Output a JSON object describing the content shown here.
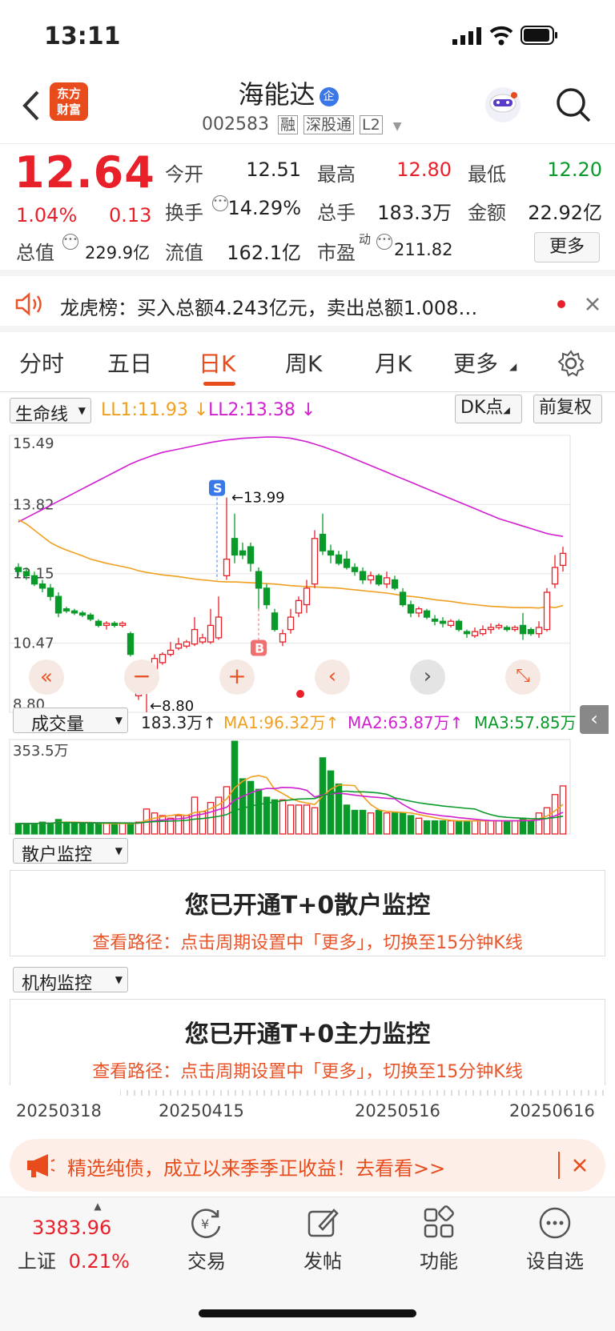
{
  "status": {
    "time": "13:11"
  },
  "header": {
    "name": "海能达",
    "name_badge": "企",
    "code": "002583",
    "tags": [
      "融",
      "深股通",
      "L2"
    ],
    "logo_top": "东方",
    "logo_bottom": "财富"
  },
  "quote": {
    "price": "12.64",
    "change_pct": "1.04%",
    "change": "0.13",
    "fields": [
      {
        "label": "今开",
        "value": "12.51",
        "color": "#222222"
      },
      {
        "label": "最高",
        "value": "12.80",
        "color": "#e8202a"
      },
      {
        "label": "最低",
        "value": "12.20",
        "color": "#0a9a2a"
      },
      {
        "label": "换手",
        "value": "14.29%",
        "color": "#222222"
      },
      {
        "label": "总手",
        "value": "183.3万",
        "color": "#222222"
      },
      {
        "label": "金额",
        "value": "22.92亿",
        "color": "#222222"
      },
      {
        "label": "总值",
        "value": "229.9亿",
        "color": "#222222"
      },
      {
        "label": "流值",
        "value": "162.1亿",
        "color": "#222222"
      },
      {
        "label": "市盈",
        "value": "211.82",
        "color": "#222222"
      }
    ],
    "pe_sup": "动",
    "more_label": "更多"
  },
  "notice": {
    "text": "龙虎榜：买入总额4.243亿元，卖出总额1.008…"
  },
  "tabs": [
    "分时",
    "五日",
    "日K",
    "周K",
    "月K",
    "更多"
  ],
  "active_tab": "日K",
  "indicator": {
    "selector": "生命线",
    "ll1": "LL1:11.93",
    "ll2": "LL2:13.38",
    "dk_label": "DK点",
    "fq_label": "前复权"
  },
  "chart_data": {
    "type": "candlestick",
    "y_axis_labels": [
      "15.49",
      "13.82",
      "12.15",
      "10.47",
      "8.80"
    ],
    "ylim": [
      8.8,
      15.49
    ],
    "annotations": [
      {
        "label": "S",
        "value": "13.99"
      },
      {
        "label": "B",
        "value": ""
      },
      {
        "label": "low",
        "value": "8.80"
      }
    ],
    "candles": [
      [
        12.3,
        12.2,
        12.4,
        12.1
      ],
      [
        12.2,
        12.1,
        12.3,
        12.0
      ],
      [
        12.1,
        11.9,
        12.2,
        11.85
      ],
      [
        11.9,
        11.8,
        12.0,
        11.7
      ],
      [
        11.8,
        11.6,
        11.9,
        11.5
      ],
      [
        11.6,
        11.2,
        11.7,
        11.1
      ],
      [
        11.3,
        11.25,
        11.35,
        11.2
      ],
      [
        11.25,
        11.2,
        11.3,
        11.15
      ],
      [
        11.2,
        11.15,
        11.25,
        11.1
      ],
      [
        11.15,
        11.05,
        11.2,
        11.0
      ],
      [
        11.0,
        10.9,
        11.05,
        10.85
      ],
      [
        10.9,
        10.95,
        11.0,
        10.8
      ],
      [
        10.95,
        10.9,
        11.0,
        10.85
      ],
      [
        10.9,
        10.95,
        11.0,
        10.85
      ],
      [
        10.7,
        10.2,
        10.75,
        10.15
      ],
      [
        9.2,
        9.3,
        9.5,
        9.1
      ],
      [
        9.4,
        9.7,
        9.8,
        8.8
      ],
      [
        9.85,
        10.1,
        10.2,
        9.8
      ],
      [
        10.0,
        10.2,
        10.25,
        9.95
      ],
      [
        10.2,
        10.3,
        10.5,
        10.15
      ],
      [
        10.35,
        10.45,
        10.6,
        10.3
      ],
      [
        10.4,
        10.5,
        10.55,
        10.35
      ],
      [
        10.45,
        10.8,
        11.1,
        10.4
      ],
      [
        10.5,
        10.6,
        10.7,
        10.45
      ],
      [
        10.5,
        10.9,
        11.3,
        10.45
      ],
      [
        10.6,
        11.1,
        11.6,
        10.55
      ],
      [
        12.1,
        12.5,
        13.99,
        12.0
      ],
      [
        13.0,
        12.6,
        13.6,
        12.4
      ],
      [
        12.7,
        12.6,
        12.9,
        12.5
      ],
      [
        12.8,
        12.4,
        12.9,
        12.2
      ],
      [
        12.2,
        11.8,
        12.3,
        11.3
      ],
      [
        11.8,
        11.4,
        11.9,
        11.3
      ],
      [
        11.2,
        10.8,
        11.3,
        10.75
      ],
      [
        10.5,
        10.7,
        10.8,
        10.4
      ],
      [
        10.8,
        11.1,
        11.3,
        10.7
      ],
      [
        11.2,
        11.5,
        11.6,
        11.1
      ],
      [
        11.4,
        11.8,
        12.0,
        11.2
      ],
      [
        11.9,
        13.0,
        13.2,
        11.8
      ],
      [
        13.1,
        12.7,
        13.6,
        12.6
      ],
      [
        12.7,
        12.6,
        12.85,
        12.4
      ],
      [
        12.6,
        12.4,
        12.7,
        12.35
      ],
      [
        12.5,
        12.3,
        12.7,
        12.25
      ],
      [
        12.3,
        12.2,
        12.4,
        12.1
      ],
      [
        12.2,
        12.0,
        12.3,
        11.9
      ],
      [
        12.0,
        12.1,
        12.2,
        11.9
      ],
      [
        12.1,
        11.9,
        12.15,
        11.85
      ],
      [
        11.9,
        12.05,
        12.2,
        11.8
      ],
      [
        12.0,
        11.8,
        12.1,
        11.75
      ],
      [
        11.7,
        11.4,
        11.8,
        11.35
      ],
      [
        11.4,
        11.2,
        11.5,
        11.1
      ],
      [
        11.2,
        11.3,
        11.35,
        11.1
      ],
      [
        11.25,
        11.1,
        11.3,
        11.05
      ],
      [
        11.05,
        11.0,
        11.15,
        10.9
      ],
      [
        11.0,
        10.95,
        11.1,
        10.85
      ],
      [
        10.9,
        11.0,
        11.05,
        10.85
      ],
      [
        11.0,
        10.8,
        11.05,
        10.75
      ],
      [
        10.75,
        10.7,
        10.8,
        10.6
      ],
      [
        10.65,
        10.75,
        10.85,
        10.6
      ],
      [
        10.7,
        10.8,
        10.9,
        10.65
      ],
      [
        10.8,
        10.85,
        10.95,
        10.7
      ],
      [
        10.85,
        10.9,
        10.95,
        10.8
      ],
      [
        10.85,
        10.8,
        10.9,
        10.75
      ],
      [
        10.8,
        10.85,
        10.9,
        10.75
      ],
      [
        10.9,
        10.7,
        11.2,
        10.55
      ],
      [
        10.8,
        10.7,
        10.85,
        10.65
      ],
      [
        10.7,
        10.85,
        11.0,
        10.6
      ],
      [
        10.8,
        11.7,
        11.8,
        10.75
      ],
      [
        11.9,
        12.3,
        12.6,
        11.8
      ],
      [
        12.35,
        12.64,
        12.8,
        12.2
      ]
    ],
    "ma_yellow": [
      13.45,
      13.35,
      13.2,
      13.05,
      12.9,
      12.8,
      12.72,
      12.65,
      12.58,
      12.5,
      12.45,
      12.4,
      12.36,
      12.32,
      12.28,
      12.22,
      12.18,
      12.15,
      12.12,
      12.1,
      12.08,
      12.05,
      12.02,
      12.0,
      11.98,
      11.96,
      11.95,
      11.95,
      11.94,
      11.93,
      11.92,
      11.91,
      11.9,
      11.88,
      11.86,
      11.85,
      11.84,
      11.83,
      11.82,
      11.81,
      11.8,
      11.78,
      11.76,
      11.74,
      11.72,
      11.7,
      11.68,
      11.65,
      11.62,
      11.6,
      11.58,
      11.55,
      11.52,
      11.5,
      11.48,
      11.45,
      11.42,
      11.4,
      11.38,
      11.36,
      11.35,
      11.34,
      11.33,
      11.33,
      11.33,
      11.32,
      11.35,
      11.33,
      11.38
    ],
    "ma_magenta": [
      13.4,
      13.5,
      13.6,
      13.7,
      13.8,
      13.9,
      14.0,
      14.1,
      14.2,
      14.3,
      14.4,
      14.5,
      14.6,
      14.7,
      14.8,
      14.88,
      14.95,
      15.02,
      15.08,
      15.12,
      15.16,
      15.2,
      15.24,
      15.28,
      15.32,
      15.35,
      15.38,
      15.4,
      15.42,
      15.43,
      15.44,
      15.45,
      15.45,
      15.44,
      15.42,
      15.38,
      15.34,
      15.28,
      15.22,
      15.15,
      15.08,
      15.0,
      14.92,
      14.84,
      14.76,
      14.68,
      14.6,
      14.52,
      14.44,
      14.36,
      14.28,
      14.2,
      14.12,
      14.04,
      13.96,
      13.88,
      13.8,
      13.72,
      13.64,
      13.56,
      13.48,
      13.42,
      13.36,
      13.3,
      13.24,
      13.18,
      13.12,
      13.08,
      13.05
    ]
  },
  "volume": {
    "selector": "成交量",
    "current": "183.3万",
    "ma1": "MA1:96.32万",
    "ma2": "MA2:63.87万",
    "ma3": "MA3:57.85万",
    "axis_max": "353.5万",
    "bars": [
      40,
      40,
      40,
      45,
      40,
      55,
      45,
      40,
      40,
      40,
      40,
      40,
      40,
      40,
      40,
      45,
      95,
      80,
      70,
      60,
      70,
      70,
      140,
      85,
      120,
      140,
      180,
      353,
      210,
      200,
      170,
      140,
      130,
      130,
      110,
      110,
      110,
      100,
      290,
      240,
      190,
      110,
      90,
      90,
      80,
      90,
      80,
      80,
      80,
      70,
      60,
      50,
      50,
      50,
      50,
      50,
      50,
      50,
      50,
      50,
      50,
      50,
      50,
      60,
      50,
      80,
      100,
      150,
      183
    ]
  },
  "retail": {
    "selector": "散户监控",
    "title": "您已开通T+0散户监控",
    "sub": "查看路径：点击周期设置中「更多」，切换至15分钟K线"
  },
  "inst": {
    "selector": "机构监控",
    "title": "您已开通T+0主力监控",
    "sub": "查看路径：点击周期设置中「更多」，切换至15分钟K线"
  },
  "dates": [
    "20250318",
    "20250415",
    "20250516",
    "20250616"
  ],
  "ad": {
    "text": "精选纯债，成立以来季季正收益！去看看>>"
  },
  "bottom": {
    "index_value": "3383.96",
    "index_name": "上证",
    "index_pct": "0.21%",
    "nav": [
      "交易",
      "发帖",
      "功能",
      "设自选"
    ]
  }
}
